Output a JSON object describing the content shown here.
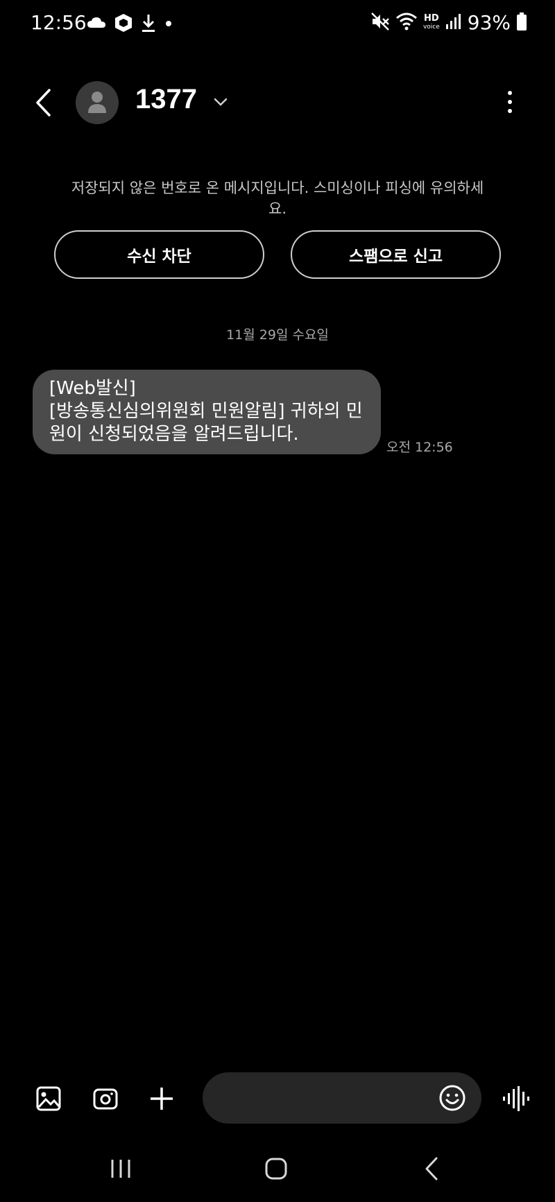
{
  "status_bar": {
    "time": "12:56",
    "battery": "93%",
    "icons_left": [
      "cloud-icon",
      "package-icon",
      "download-icon",
      "dot-icon"
    ],
    "icons_right": [
      "mute-icon",
      "wifi-icon",
      "hd-voice-icon",
      "signal-icon",
      "battery-icon"
    ],
    "hd_top": "HD",
    "hd_bottom": "voice"
  },
  "header": {
    "contact": "1377"
  },
  "warning": {
    "text": "저장되지 않은 번호로 온 메시지입니다. 스미싱이나 피싱에 유의하세요.",
    "block_label": "수신 차단",
    "report_label": "스팸으로 신고"
  },
  "conversation": {
    "date": "11월 29일 수요일",
    "messages": [
      {
        "text": "[Web발신]\n[방송통신심의위원회 민원알림] 귀하의 민원이 신청되었음을 알려드립니다.",
        "time": "오전 12:56"
      }
    ]
  },
  "colors": {
    "background": "#000000",
    "bubble": "#4b4b4b",
    "input": "#262626",
    "secondary_text": "#a9a9a9"
  }
}
